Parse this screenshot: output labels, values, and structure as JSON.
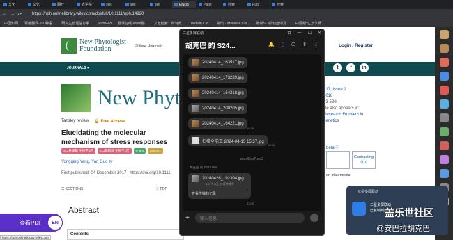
{
  "browser": {
    "tabs": [
      "文化",
      "文化",
      "翻开",
      "农学院",
      "sell",
      "sell",
      "sell",
      "Elucid",
      "Page",
      "检索",
      "Publ",
      "检索"
    ],
    "url": "https://nph.onlinelibrary.wiley.com/doi/full/10.1111/nph.14920",
    "bookmarks": [
      "中国知网",
      "百度翻译-200种语...",
      "研究生管理信息系...",
      "PubMed",
      "翻译在线-Word翻...",
      "文献检索：所有数...",
      "Metwin Clo...",
      "期刊 - Metwere Clo...",
      "最新SCI期刊查询及...",
      "EI源期刊_长江师..."
    ],
    "status_url": "https://nph.onlinelibrary.wiley.com"
  },
  "page": {
    "journal_logo": "New Phytologist\nFoundation",
    "affiliation": "Shihezi University",
    "login": "Login / Register",
    "nav_journals": "JOURNALS ▾",
    "social": [
      "t",
      "f",
      "in"
    ],
    "big_title": "New Phyto",
    "review_type": "Tansley review",
    "free_access": "🔓 Free Access",
    "article_title": "Elucidating the molecular mechanism of stress responses",
    "tags": [
      {
        "label": "SCI升级版 生物学1区",
        "color": "#e0607a"
      },
      {
        "label": "SCI基础版 生物学1区",
        "color": "#e0607a"
      },
      {
        "label": "IF 9.4",
        "color": "#4aa86e"
      },
      {
        "label": "SWJTU",
        "color": "#c9a33b"
      }
    ],
    "authors": "Yongqing Yang, Yan Guo ✉",
    "published": "First published: 04 December 2017  |  https://doi.org/10.1111",
    "sections": "☰ SECTIONS",
    "pdf": "📄 PDF",
    "abstract": "Abstract",
    "contents": "Contents",
    "view_pdf": "查看PDF",
    "lang": "EN",
    "right_info": [
      "217, Issue 2",
      "2018",
      "23-539",
      "cle also appears in:",
      "Research Frontiers in",
      "genetics"
    ],
    "beta": "beta ⓘ",
    "right_boxes": [
      "",
      "Contrasting\n⓪ 0"
    ],
    "statements": "on statements"
  },
  "chat": {
    "app_title": "三星多屏联动",
    "contact": "胡克巴 的 S24...",
    "files": [
      {
        "name": "20240414_163517.jpg",
        "thumb": "photo"
      },
      {
        "name": "20240414_173239.jpg",
        "thumb": "photo"
      },
      {
        "name": "20240414_164218.jpg",
        "thumb": "photo"
      },
      {
        "name": "20240414_200205.jpg",
        "thumb": "gray"
      },
      {
        "name": "20240414_164221.jpg",
        "thumb": "photo"
      },
      {
        "name": "扫描全能王 2024-04-15 15.37.jpg",
        "thumb": "doc"
      }
    ],
    "time1": "15:36",
    "time2": "15:38",
    "date_divider": "2024年04月26日",
    "sender": "胡克巴 的 S24 Ultra",
    "card_file": "20240426_192304.jpg",
    "card_sub": "135 千以上 持续传输中",
    "card_action": "查看传输的记录",
    "time3": "13:05",
    "input_placeholder": "输入信息"
  },
  "toast": {
    "app": "三星多屏联动",
    "message_line1": "三星多屏联动",
    "message_line2": "已复制到剪贴板"
  },
  "watermark": {
    "line1": "盖乐世社区",
    "line2": "@安巴拉胡克巴"
  }
}
